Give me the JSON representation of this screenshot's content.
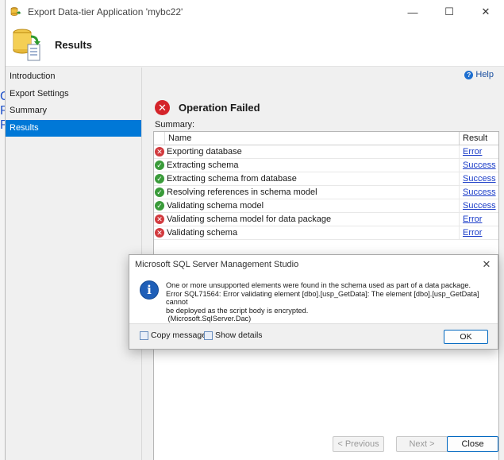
{
  "window": {
    "title": "Export Data-tier Application 'mybc22'",
    "controls": {
      "minimize": "—",
      "maximize": "☐",
      "close": "✕"
    }
  },
  "header": {
    "title": "Results"
  },
  "background": {
    "letters": [
      "C",
      "R",
      "R"
    ]
  },
  "sidebar": {
    "items": [
      {
        "label": "Introduction",
        "active": false
      },
      {
        "label": "Export Settings",
        "active": false
      },
      {
        "label": "Summary",
        "active": false
      },
      {
        "label": "Results",
        "active": true
      }
    ]
  },
  "help": {
    "label": "Help"
  },
  "status": {
    "icon": "error-icon",
    "text": "Operation Failed"
  },
  "summary": {
    "label": "Summary:",
    "columns": {
      "name": "Name",
      "result": "Result"
    },
    "rows": [
      {
        "icon": "error",
        "name": "Exporting database",
        "result": "Error"
      },
      {
        "icon": "success",
        "name": "Extracting schema",
        "result": "Success"
      },
      {
        "icon": "success",
        "name": "Extracting schema from database",
        "result": "Success"
      },
      {
        "icon": "success",
        "name": "Resolving references in schema model",
        "result": "Success"
      },
      {
        "icon": "success",
        "name": "Validating schema model",
        "result": "Success"
      },
      {
        "icon": "error",
        "name": "Validating schema model for data package",
        "result": "Error"
      },
      {
        "icon": "error",
        "name": "Validating schema",
        "result": "Error"
      }
    ]
  },
  "footer": {
    "previous": "< Previous",
    "next": "Next >",
    "close": "Close"
  },
  "message_box": {
    "title": "Microsoft SQL Server Management Studio",
    "lines": [
      "One or more unsupported elements were found in the schema used as part of a data package.",
      "Error SQL71564: Error validating element [dbo].[usp_GetData]: The element [dbo].[usp_GetData] cannot",
      "be deployed as the script body is encrypted.",
      " (Microsoft.SqlServer.Dac)"
    ],
    "copy_message": "Copy message",
    "show_details": "Show details",
    "ok": "OK"
  },
  "colors": {
    "accent": "#0078d7",
    "error": "#d23a3e",
    "success": "#3a9b3a",
    "link": "#1a3cc8"
  }
}
